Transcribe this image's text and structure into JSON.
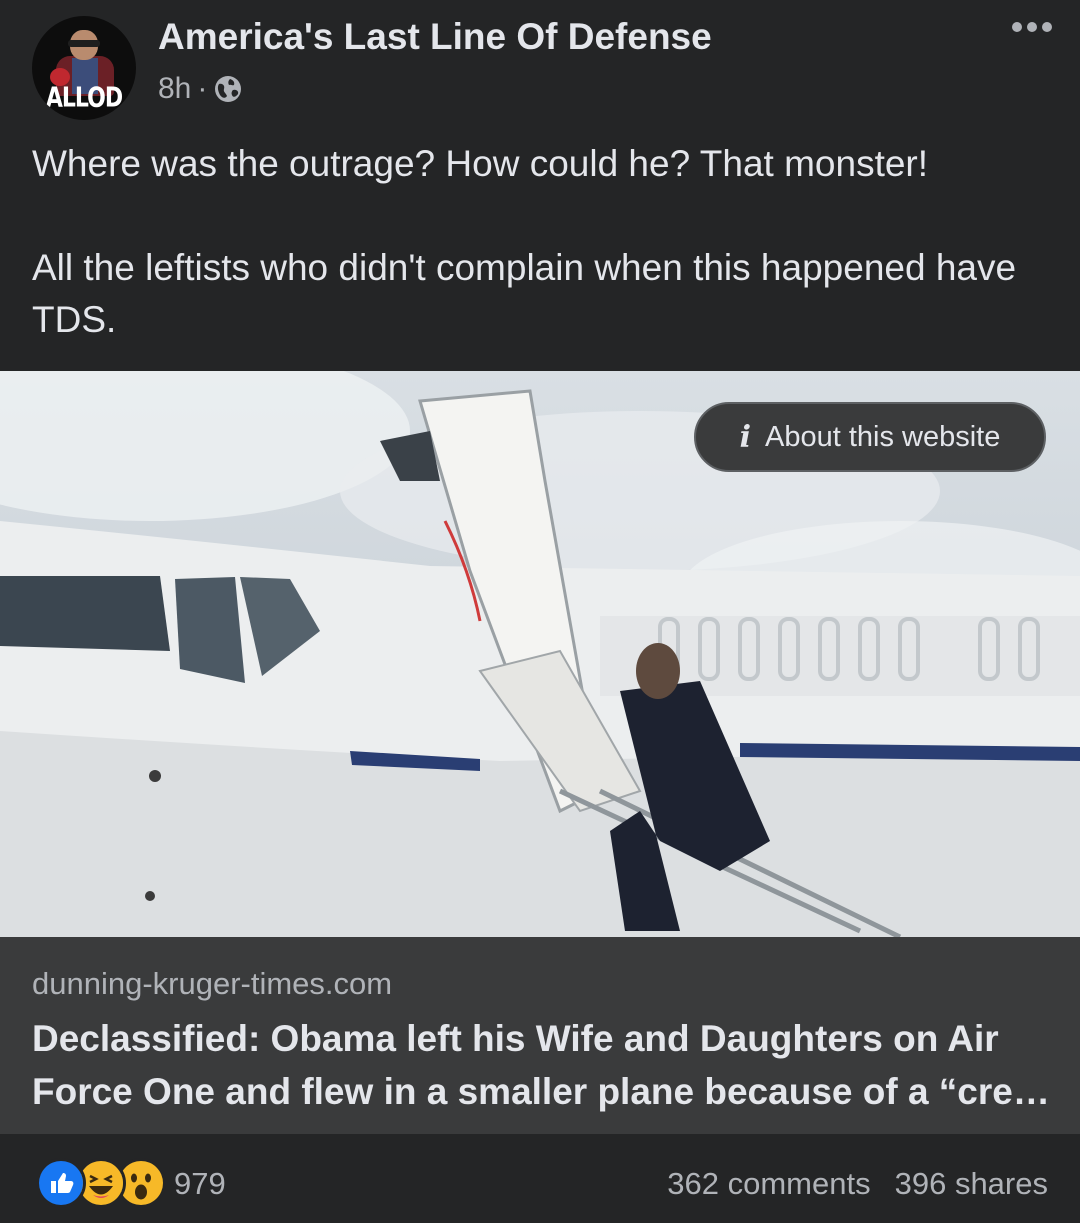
{
  "post": {
    "page_name": "America's Last Line Of Defense",
    "avatar_text": "ALLOD",
    "time": "8h",
    "separator": "·",
    "audience_icon": "globe-icon",
    "text_paragraphs": [
      "Where was the outrage? How could he? That monster!",
      "All the leftists who didn't complain when this happened have TDS."
    ]
  },
  "image_overlay": {
    "about_label": "About this website",
    "about_icon": "info-icon"
  },
  "link": {
    "domain": "dunning-kruger-times.com",
    "headline": "Declassified: Obama left his Wife and Daughters on Air Force One and flew in a smaller plane because of a “cre…"
  },
  "footer": {
    "reaction_icons": [
      "like-icon",
      "haha-icon",
      "wow-icon"
    ],
    "reaction_count": "979",
    "comments": "362 comments",
    "shares": "396 shares"
  },
  "colors": {
    "background": "#242526",
    "link_box": "#3a3b3c",
    "primary_text": "#e4e6eb",
    "secondary_text": "#b0b3b8",
    "like_blue": "#1877f2",
    "emoji_yellow": "#f7b928"
  }
}
